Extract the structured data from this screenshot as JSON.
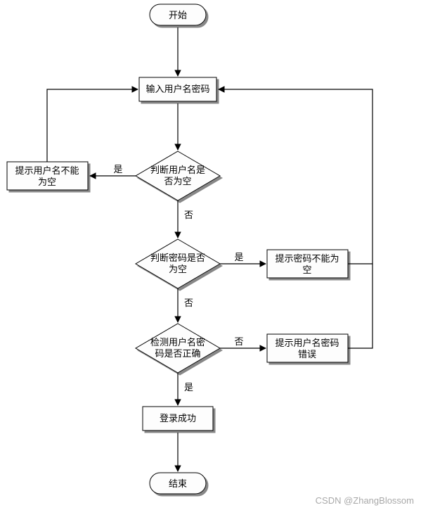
{
  "nodes": {
    "start": "开始",
    "input": "输入用户名密码",
    "check_user_empty": "判断用户名是否为空",
    "tip_user_empty": "提示用户名不能为空",
    "check_pwd_empty": "判断密码是否为空",
    "tip_pwd_empty": "提示密码不能为空",
    "check_correct": "检测用户名密码是否正确",
    "tip_wrong": "提示用户名密码错误",
    "login_ok": "登录成功",
    "end": "结束"
  },
  "labels": {
    "yes": "是",
    "no": "否"
  },
  "watermark": "CSDN @ZhangBlossom"
}
